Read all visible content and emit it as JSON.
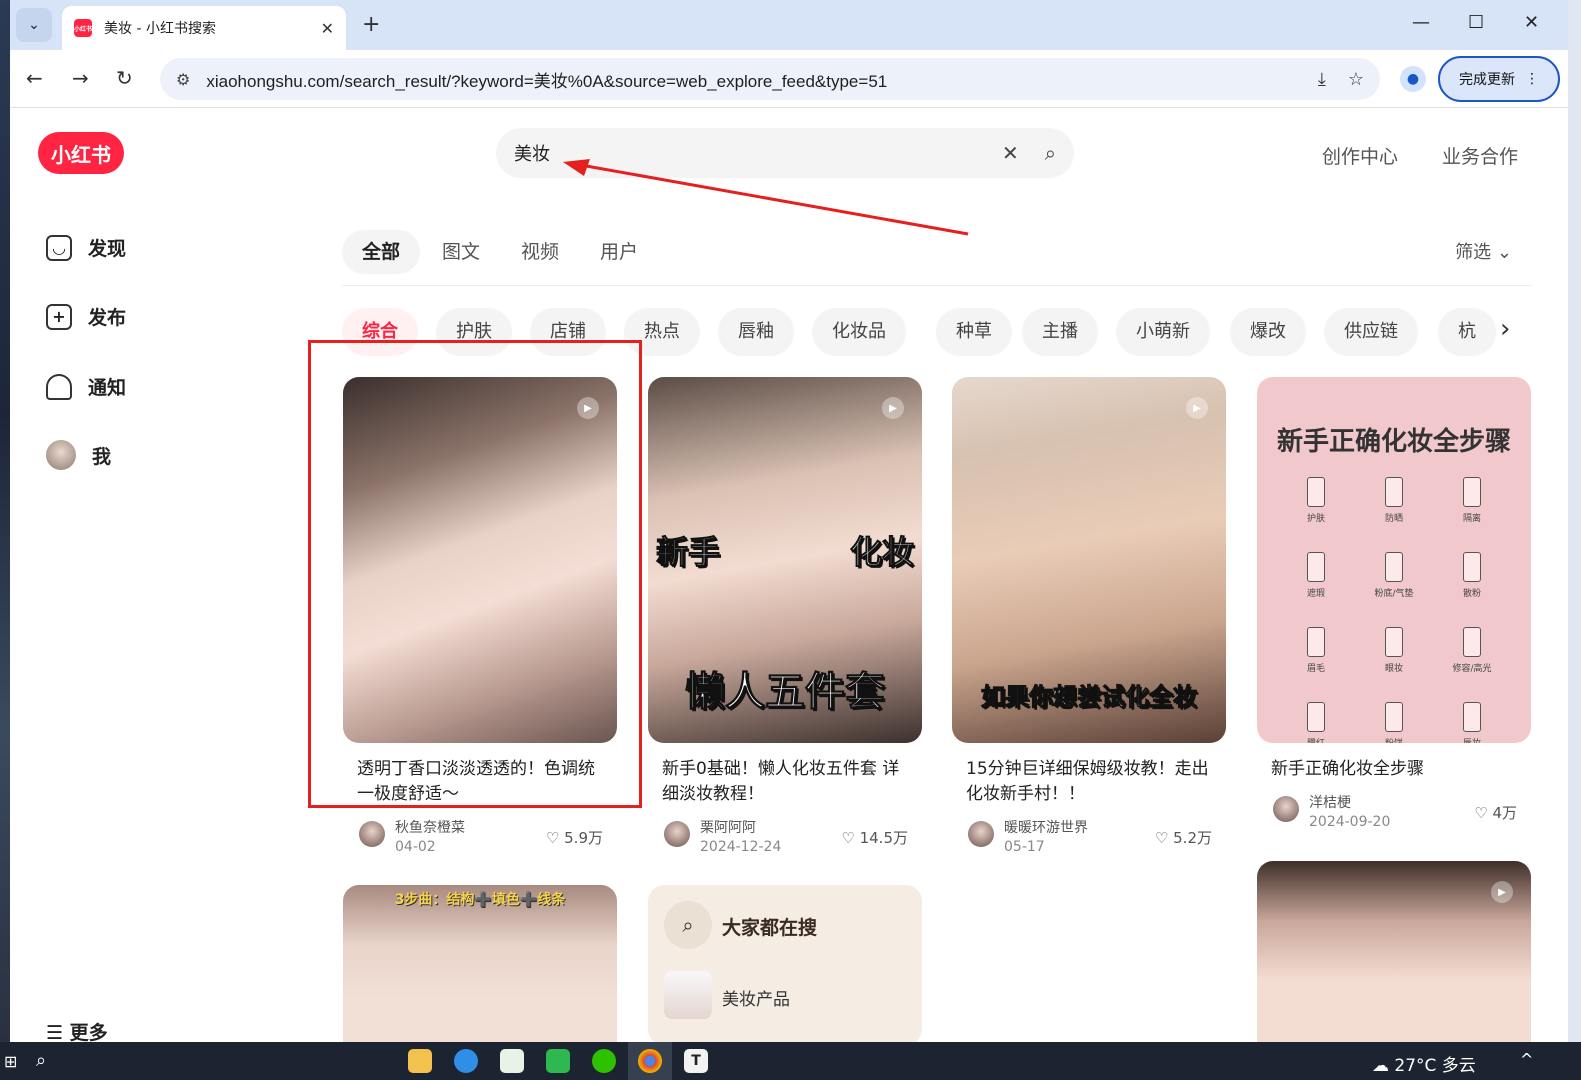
{
  "browser": {
    "tab_title": "美妆 - 小红书搜索",
    "tab_favicon_text": "小红书",
    "url": "xiaohongshu.com/search_result/?keyword=美妆%0A&source=web_explore_feed&type=51",
    "update_label": "完成更新"
  },
  "site": {
    "logo": "小红书",
    "search_value": "美妆",
    "top_links": [
      "创作中心",
      "业务合作"
    ]
  },
  "sidebar": {
    "items": [
      {
        "label": "发现",
        "icon": "home-icon"
      },
      {
        "label": "发布",
        "icon": "plus-icon"
      },
      {
        "label": "通知",
        "icon": "bell-icon"
      },
      {
        "label": "我",
        "icon": "avatar"
      }
    ],
    "more_label": "更多"
  },
  "tabs": [
    "全部",
    "图文",
    "视频",
    "用户"
  ],
  "filter_label": "筛选",
  "chips": [
    "综合",
    "护肤",
    "店铺",
    "热点",
    "唇釉",
    "化妆品",
    "种草",
    "主播",
    "小萌新",
    "爆改",
    "供应链",
    "杭"
  ],
  "cards": [
    {
      "title": "透明丁香口淡淡透透的！色调统一极度舒适～",
      "author": "秋鱼奈橙菜",
      "date": "04-02",
      "likes": "5.9万",
      "video": true,
      "overlay": ""
    },
    {
      "title": "新手0基础！懒人化妆五件套 详细淡妆教程！",
      "author": "栗阿阿阿",
      "date": "2024-12-24",
      "likes": "14.5万",
      "video": true,
      "overlay": "懒人五件套",
      "overlay_top": [
        "新手",
        "化妆"
      ]
    },
    {
      "title": "15分钟巨详细保姆级妆教！走出化妆新手村！！",
      "author": "暖暖环游世界",
      "date": "05-17",
      "likes": "5.2万",
      "video": true,
      "overlay": "如果你想尝试化全妆"
    },
    {
      "title": "新手正确化妆全步骤",
      "author": "洋桔梗",
      "date": "2024-09-20",
      "likes": "4万",
      "video": false,
      "overlay": "新手正确化妆全步骤"
    }
  ],
  "infographic_steps": [
    "护肤",
    "防晒",
    "隔离",
    "遮瑕",
    "粉底/气垫",
    "散粉",
    "眉毛",
    "眼妆",
    "修容/高光",
    "腮红",
    "粉饼",
    "唇妆"
  ],
  "row2_card1_overlay": "3步曲：结构➕填色➕线条",
  "hot_search": {
    "title": "大家都在搜",
    "items": [
      "美妆产品"
    ]
  },
  "taskbar": {
    "weather": "27°C 多云"
  },
  "colors": {
    "brand": "#ff2442",
    "annotation": "#e5201e"
  }
}
